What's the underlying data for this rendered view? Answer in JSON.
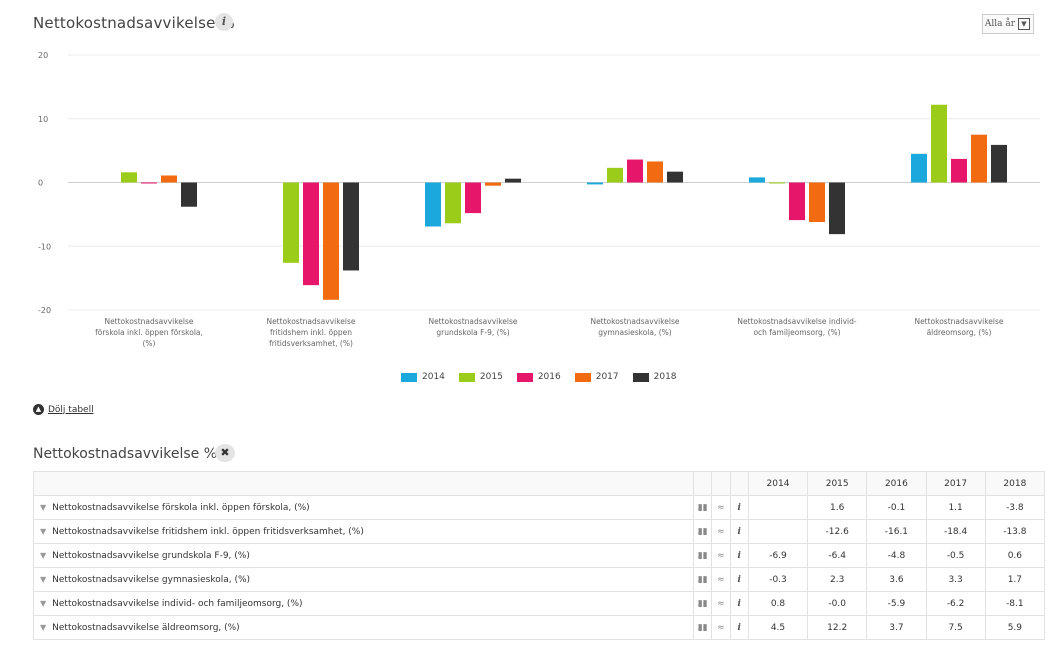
{
  "header": {
    "title": "Nettokostnadsavvikelse %",
    "info_icon": "i",
    "year_select": "Alla år"
  },
  "colors": {
    "2014": "#1ba8dc",
    "2015": "#9ccc1a",
    "2016": "#e6176a",
    "2017": "#f26b11",
    "2018": "#333333"
  },
  "chart_data": {
    "type": "bar",
    "ylim": [
      -20,
      20
    ],
    "yticks": [
      "20",
      "10",
      "0",
      "-10",
      "-20"
    ],
    "ytick_values": [
      20,
      10,
      0,
      -10,
      -20
    ],
    "grid": true,
    "legend_position": "bottom",
    "categories": [
      [
        "Nettokostnadsavvikelse",
        "förskola inkl. öppen förskola,",
        "(%)"
      ],
      [
        "Nettokostnadsavvikelse",
        "fritidshem inkl. öppen",
        "fritidsverksamhet, (%)"
      ],
      [
        "Nettokostnadsavvikelse",
        "grundskola F-9, (%)"
      ],
      [
        "Nettokostnadsavvikelse",
        "gymnasieskola, (%)"
      ],
      [
        "Nettokostnadsavvikelse individ-",
        "och familjeomsorg, (%)"
      ],
      [
        "Nettokostnadsavvikelse",
        "äldreomsorg, (%)"
      ]
    ],
    "series": [
      {
        "name": "2014",
        "values": [
          null,
          null,
          -6.9,
          -0.3,
          0.8,
          4.5
        ]
      },
      {
        "name": "2015",
        "values": [
          1.6,
          -12.6,
          -6.4,
          2.3,
          -0.0,
          12.2
        ]
      },
      {
        "name": "2016",
        "values": [
          -0.1,
          -16.1,
          -4.8,
          3.6,
          -5.9,
          3.7
        ]
      },
      {
        "name": "2017",
        "values": [
          1.1,
          -18.4,
          -0.5,
          3.3,
          -6.2,
          7.5
        ]
      },
      {
        "name": "2018",
        "values": [
          -3.8,
          -13.8,
          0.6,
          1.7,
          -8.1,
          5.9
        ]
      }
    ]
  },
  "legend": [
    "2014",
    "2015",
    "2016",
    "2017",
    "2018"
  ],
  "hide_table_label": "Dölj tabell",
  "table": {
    "title": "Nettokostnadsavvikelse %",
    "close_icon": "✖",
    "years": [
      "2014",
      "2015",
      "2016",
      "2017",
      "2018"
    ],
    "rows": [
      {
        "label": "Nettokostnadsavvikelse förskola inkl. öppen förskola, (%)",
        "values": [
          "",
          "1.6",
          "-0.1",
          "1.1",
          "-3.8"
        ]
      },
      {
        "label": "Nettokostnadsavvikelse fritidshem inkl. öppen fritidsverksamhet, (%)",
        "values": [
          "",
          "-12.6",
          "-16.1",
          "-18.4",
          "-13.8"
        ]
      },
      {
        "label": "Nettokostnadsavvikelse grundskola F-9, (%)",
        "values": [
          "-6.9",
          "-6.4",
          "-4.8",
          "-0.5",
          "0.6"
        ]
      },
      {
        "label": "Nettokostnadsavvikelse gymnasieskola, (%)",
        "values": [
          "-0.3",
          "2.3",
          "3.6",
          "3.3",
          "1.7"
        ]
      },
      {
        "label": "Nettokostnadsavvikelse individ- och familjeomsorg, (%)",
        "values": [
          "0.8",
          "-0.0",
          "-5.9",
          "-6.2",
          "-8.1"
        ]
      },
      {
        "label": "Nettokostnadsavvikelse äldreomsorg, (%)",
        "values": [
          "4.5",
          "12.2",
          "3.7",
          "7.5",
          "5.9"
        ]
      }
    ]
  }
}
